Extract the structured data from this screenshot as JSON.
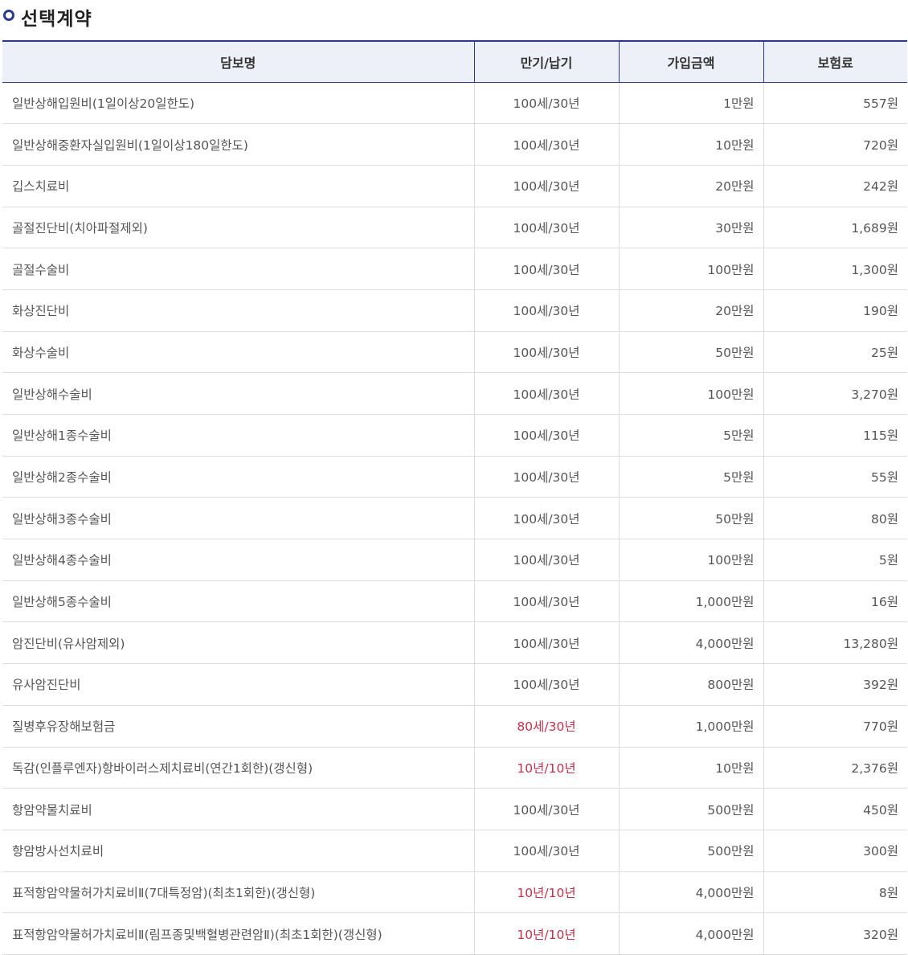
{
  "section_title": "선택계약",
  "table": {
    "headers": [
      "담보명",
      "만기/납기",
      "가입금액",
      "보험료"
    ],
    "rows": [
      {
        "name": "일반상해입원비(1일이상20일한도)",
        "term": "100세/30년",
        "amount": "1만원",
        "premium": "557원",
        "term_highlight": false
      },
      {
        "name": "일반상해중환자실입원비(1일이상180일한도)",
        "term": "100세/30년",
        "amount": "10만원",
        "premium": "720원",
        "term_highlight": false
      },
      {
        "name": "깁스치료비",
        "term": "100세/30년",
        "amount": "20만원",
        "premium": "242원",
        "term_highlight": false
      },
      {
        "name": "골절진단비(치아파절제외)",
        "term": "100세/30년",
        "amount": "30만원",
        "premium": "1,689원",
        "term_highlight": false
      },
      {
        "name": "골절수술비",
        "term": "100세/30년",
        "amount": "100만원",
        "premium": "1,300원",
        "term_highlight": false
      },
      {
        "name": "화상진단비",
        "term": "100세/30년",
        "amount": "20만원",
        "premium": "190원",
        "term_highlight": false
      },
      {
        "name": "화상수술비",
        "term": "100세/30년",
        "amount": "50만원",
        "premium": "25원",
        "term_highlight": false
      },
      {
        "name": "일반상해수술비",
        "term": "100세/30년",
        "amount": "100만원",
        "premium": "3,270원",
        "term_highlight": false
      },
      {
        "name": "일반상해1종수술비",
        "term": "100세/30년",
        "amount": "5만원",
        "premium": "115원",
        "term_highlight": false
      },
      {
        "name": "일반상해2종수술비",
        "term": "100세/30년",
        "amount": "5만원",
        "premium": "55원",
        "term_highlight": false
      },
      {
        "name": "일반상해3종수술비",
        "term": "100세/30년",
        "amount": "50만원",
        "premium": "80원",
        "term_highlight": false
      },
      {
        "name": "일반상해4종수술비",
        "term": "100세/30년",
        "amount": "100만원",
        "premium": "5원",
        "term_highlight": false
      },
      {
        "name": "일반상해5종수술비",
        "term": "100세/30년",
        "amount": "1,000만원",
        "premium": "16원",
        "term_highlight": false
      },
      {
        "name": "암진단비(유사암제외)",
        "term": "100세/30년",
        "amount": "4,000만원",
        "premium": "13,280원",
        "term_highlight": false
      },
      {
        "name": "유사암진단비",
        "term": "100세/30년",
        "amount": "800만원",
        "premium": "392원",
        "term_highlight": false
      },
      {
        "name": "질병후유장해보험금",
        "term": "80세/30년",
        "amount": "1,000만원",
        "premium": "770원",
        "term_highlight": true
      },
      {
        "name": "독감(인플루엔자)항바이러스제치료비(연간1회한)(갱신형)",
        "term": "10년/10년",
        "amount": "10만원",
        "premium": "2,376원",
        "term_highlight": true
      },
      {
        "name": "항암약물치료비",
        "term": "100세/30년",
        "amount": "500만원",
        "premium": "450원",
        "term_highlight": false
      },
      {
        "name": "항암방사선치료비",
        "term": "100세/30년",
        "amount": "500만원",
        "premium": "300원",
        "term_highlight": false
      },
      {
        "name": "표적항암약물허가치료비Ⅱ(7대특정암)(최초1회한)(갱신형)",
        "term": "10년/10년",
        "amount": "4,000만원",
        "premium": "8원",
        "term_highlight": true
      },
      {
        "name": "표적항암약물허가치료비Ⅱ(림프종및백혈병관련암Ⅱ)(최초1회한)(갱신형)",
        "term": "10년/10년",
        "amount": "4,000만원",
        "premium": "320원",
        "term_highlight": true
      }
    ]
  },
  "colors": {
    "accent": "#2a3a8f",
    "header_bg": "#eef0f9",
    "highlight_term": "#c0314a"
  },
  "icons": {
    "title_bullet": "circle-bullet-icon"
  }
}
